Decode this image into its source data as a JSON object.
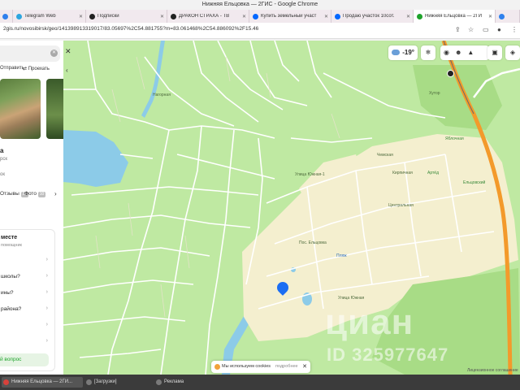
{
  "window": {
    "title": "Нижняя Ельцовка — 2ГИС - Google Chrome"
  },
  "tabs": [
    {
      "label": "",
      "color": "#2f80ed"
    },
    {
      "label": "Telegram Web",
      "color": "#2ea6df"
    },
    {
      "label": "Подписки",
      "color": "#222222"
    },
    {
      "label": "ДРАКОН СТРАХА - ТВ",
      "color": "#222222"
    },
    {
      "label": "Купить земельный участ",
      "color": "#0468ff"
    },
    {
      "label": "Продаю участок 10сот.",
      "color": "#0468ff"
    },
    {
      "label": "Нижняя Ельцовка — 2ГИ",
      "color": "#1fa32c",
      "active": true
    },
    {
      "label": "",
      "color": "#2f80ed"
    }
  ],
  "address": {
    "url": "2gis.ru/novosibirsk/geo/141398913319017/83.05697%2C54.881755?m=83.061468%2C54.886092%2F15.46"
  },
  "panel": {
    "actions": [
      "Отправить",
      "Проехать"
    ],
    "title_fragment": "а",
    "subtitle_fragment": "рск",
    "line3_fragment": "ок",
    "tab_reviews": "Отзывы",
    "reviews_count": "20",
    "tab_photos": "Фото",
    "photos_count": "10",
    "card_title": "месте",
    "card_subtitle": "помощник",
    "questions": [
      "",
      "школы?",
      "ины?",
      "района?",
      "",
      ""
    ],
    "ask_button": "й вопрос"
  },
  "map": {
    "temperature": "-19°",
    "labels": {
      "yuzhny": "Улица Южная",
      "chemskaya": "Чемская",
      "kirpichnaya": "Кирпичная",
      "yuzhnaya2": "Улица Южная-1",
      "tsentralnaya": "Центральная",
      "arbuz": "Артёд",
      "nagorn": "Нагорная",
      "turbaza": "Пляж",
      "derevnya": "Пос. Ельцовка",
      "khutor": "Хутор",
      "yablochnaya": "Яблочная",
      "elts": "Ельцовский"
    },
    "watermark_1": "циан",
    "watermark_2": "ID 325977647",
    "copyright": "Лицензионное соглашение",
    "cookie_text": "Мы используем cookies",
    "cookie_link": "подробнее"
  },
  "taskbar": [
    {
      "label": "Нижняя Ельцовка — 2ГИ...",
      "color": "#d8413b",
      "active": true
    },
    {
      "label": "[Загрузки]",
      "color": "#7a7a7a"
    },
    {
      "label": "Реклама",
      "color": "#7a7a7a"
    }
  ]
}
